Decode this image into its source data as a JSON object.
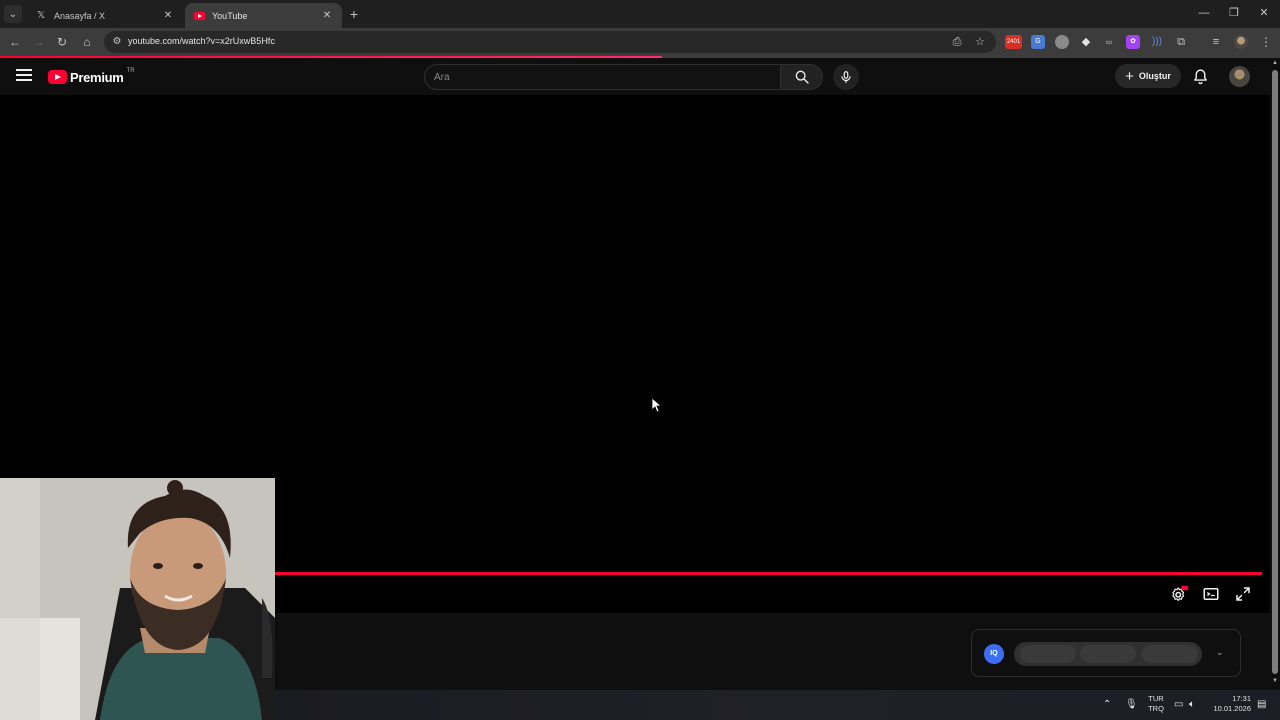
{
  "browser": {
    "tabs": [
      {
        "title": "Anasayfa / X",
        "favicon": "x-logo-icon",
        "active": false
      },
      {
        "title": "YouTube",
        "favicon": "youtube-icon",
        "active": true
      }
    ],
    "address_url": "youtube.com/watch?v=x2rUxwB5Hfc",
    "extensions": [
      {
        "name": "ext-red-badge",
        "badge": "2401",
        "color": "#d93025"
      },
      {
        "name": "ext-translate",
        "color": "#4a7bd4"
      },
      {
        "name": "ext-grey",
        "color": "#8a8a8a"
      },
      {
        "name": "ext-diamond",
        "color": "#e3e3e3"
      },
      {
        "name": "ext-glasses",
        "color": "#aaaaaa"
      },
      {
        "name": "ext-purple",
        "color": "#a142f4"
      },
      {
        "name": "ext-wave",
        "color": "#5b8def"
      }
    ]
  },
  "youtube": {
    "logo_text": "Premium",
    "country_code": "TR",
    "search_placeholder": "Ara",
    "create_label": "Oluştur",
    "accent_color": "#ff0033"
  },
  "player": {
    "progress_fraction": 1.0
  },
  "widget": {
    "badge_text": "IQ"
  },
  "taskbar": {
    "lang_top": "TUR",
    "lang_bottom": "TRQ",
    "time": "17:31",
    "date": "10.01.2026"
  }
}
